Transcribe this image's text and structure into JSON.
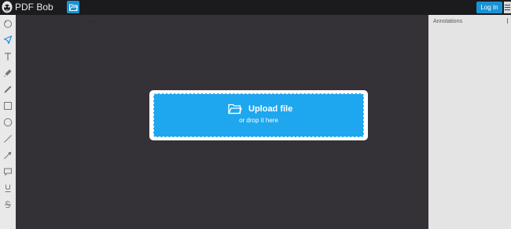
{
  "app": {
    "name": "PDF Bob"
  },
  "header": {
    "login_label": "Log In"
  },
  "toolbar": {
    "tools": [
      "pan-tool-icon",
      "select-tool-icon",
      "text-tool-icon",
      "highlighter-tool-icon",
      "pencil-tool-icon",
      "rectangle-tool-icon",
      "ellipse-tool-icon",
      "line-tool-icon",
      "arrow-tool-icon",
      "comment-tool-icon",
      "underline-tool-icon",
      "strikethrough-tool-icon"
    ],
    "active_tool": "select-tool-icon"
  },
  "dropzone": {
    "title": "Upload file",
    "hint": "or drop it here"
  },
  "annotations_panel": {
    "title": "Annotations"
  },
  "colors": {
    "accent": "#1a93d6",
    "dropzone": "#1ea7ef",
    "canvas": "#343236"
  }
}
